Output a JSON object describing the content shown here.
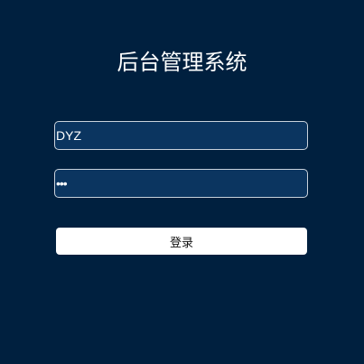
{
  "page": {
    "title": "后台管理系统"
  },
  "form": {
    "username_value": "DYZ",
    "password_value": "•••",
    "login_label": "登录"
  },
  "colors": {
    "background": "#00203f",
    "input_background": "#0b3560",
    "input_border": "#c9d2dc",
    "button_background": "#ffffff"
  }
}
